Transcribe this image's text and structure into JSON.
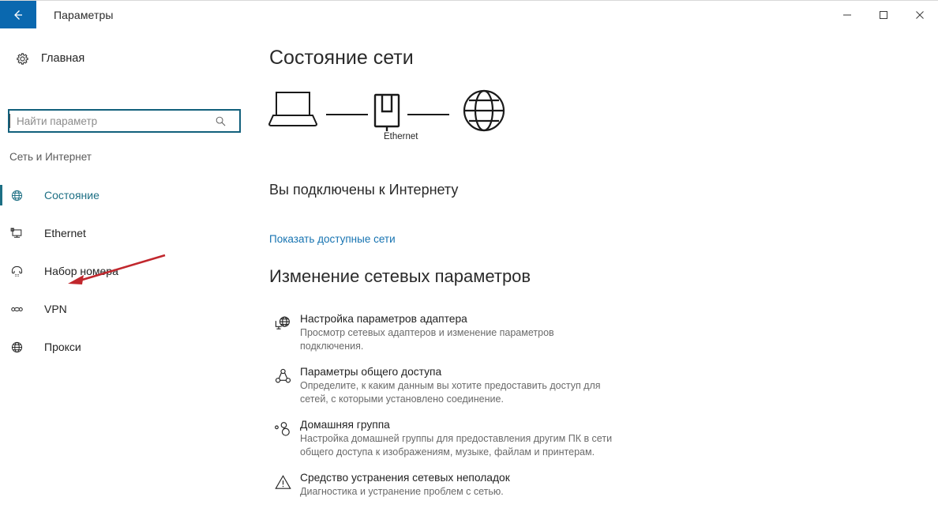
{
  "window": {
    "title": "Параметры",
    "back_icon": "back-arrow-icon",
    "minimize_label": "Свернуть",
    "maximize_label": "Развернуть",
    "close_label": "Закрыть"
  },
  "sidebar": {
    "home": {
      "label": "Главная",
      "icon": "gear-icon"
    },
    "search": {
      "value": "",
      "placeholder": "Найти параметр",
      "icon": "search-icon"
    },
    "group_label": "Сеть и Интернет",
    "items": [
      {
        "label": "Состояние",
        "icon": "globe-icon",
        "selected": true
      },
      {
        "label": "Ethernet",
        "icon": "monitor-icon",
        "selected": false
      },
      {
        "label": "Набор номера",
        "icon": "phone-icon",
        "selected": false
      },
      {
        "label": "VPN",
        "icon": "vpn-link-icon",
        "selected": false
      },
      {
        "label": "Прокси",
        "icon": "globe-icon",
        "selected": false
      }
    ]
  },
  "main": {
    "page_title": "Состояние сети",
    "diagram": {
      "device_icon": "laptop-icon",
      "connector_icon": "ethernet-port-icon",
      "internet_icon": "globe-icon",
      "connection_label": "Ethernet"
    },
    "status_line": "Вы подключены к Интернету",
    "link": "Показать доступные сети",
    "section_title": "Изменение сетевых параметров",
    "items": [
      {
        "icon": "adapter-settings-icon",
        "title": "Настройка параметров адаптера",
        "desc": "Просмотр сетевых адаптеров и изменение параметров подключения."
      },
      {
        "icon": "sharing-icon",
        "title": "Параметры общего доступа",
        "desc": "Определите, к каким данным вы хотите предоставить доступ для сетей, с которыми установлено соединение."
      },
      {
        "icon": "homegroup-icon",
        "title": "Домашняя группа",
        "desc": "Настройка домашней группы для предоставления другим ПК в сети общего доступа к изображениям, музыке, файлам и принтерам."
      },
      {
        "icon": "warning-triangle-icon",
        "title": "Средство устранения сетевых неполадок",
        "desc": "Диагностика и устранение проблем с сетью."
      }
    ]
  },
  "annotation": {
    "arrow_icon": "red-pointer-arrow",
    "color": "#c1272d",
    "points_at": "VPN"
  },
  "colors": {
    "accent_blue": "#0a68af",
    "selected_teal": "#1d6f84",
    "link_blue": "#1673b1",
    "search_border": "#12607c",
    "annotation_red": "#c1272d"
  }
}
